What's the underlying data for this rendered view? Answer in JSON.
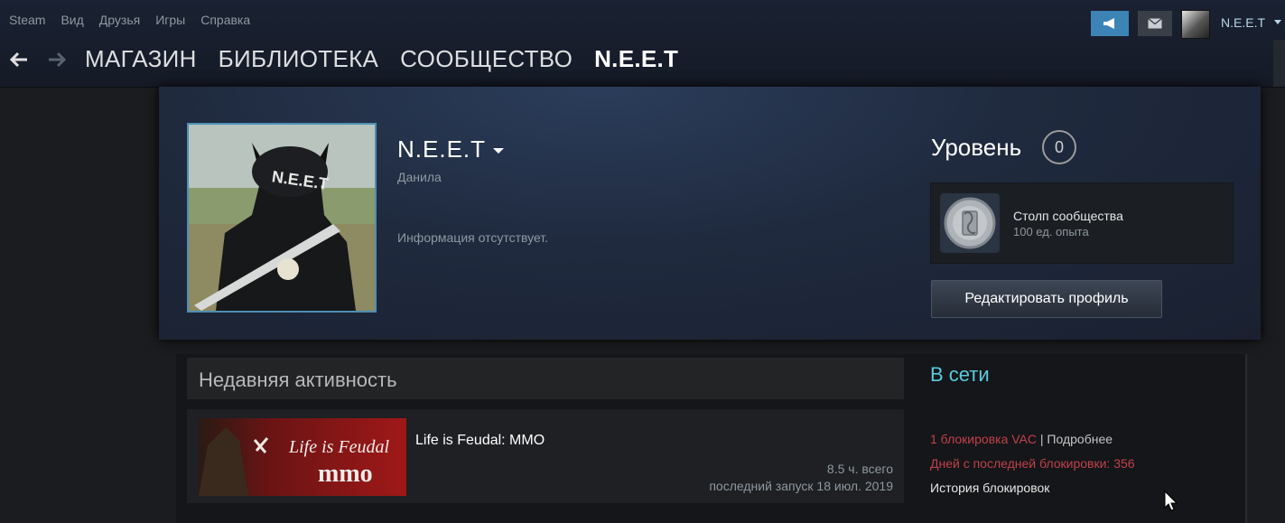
{
  "menu": [
    "Steam",
    "Вид",
    "Друзья",
    "Игры",
    "Справка"
  ],
  "nav": {
    "tabs": [
      "МАГАЗИН",
      "БИБЛИОТЕКА",
      "СООБЩЕСТВО",
      "N.E.E.T"
    ]
  },
  "account": {
    "name": "N.E.E.T"
  },
  "profile": {
    "persona": "N.E.E.T",
    "real_name": "Данила",
    "summary": "Информация отсутствует.",
    "level_label": "Уровень",
    "level": "0",
    "badge": {
      "name": "Столп сообщества",
      "xp": "100 ед. опыта"
    },
    "edit_button": "Редактировать профиль",
    "avatar_text": "N.E.E.T"
  },
  "activity": {
    "title": "Недавняя активность",
    "game": {
      "name": "Life is Feudal: MMO",
      "logo_line1": "Life is Feudal",
      "logo_line2": "mmo",
      "hours": "8.5 ч. всего",
      "last_played": "последний запуск 18 июл. 2019"
    }
  },
  "status": {
    "online": "В сети",
    "vac": "1 блокировка VAC",
    "separator": " | ",
    "details": "Подробнее",
    "days_since": "Дней с последней блокировки: 356",
    "history": "История блокировок"
  }
}
